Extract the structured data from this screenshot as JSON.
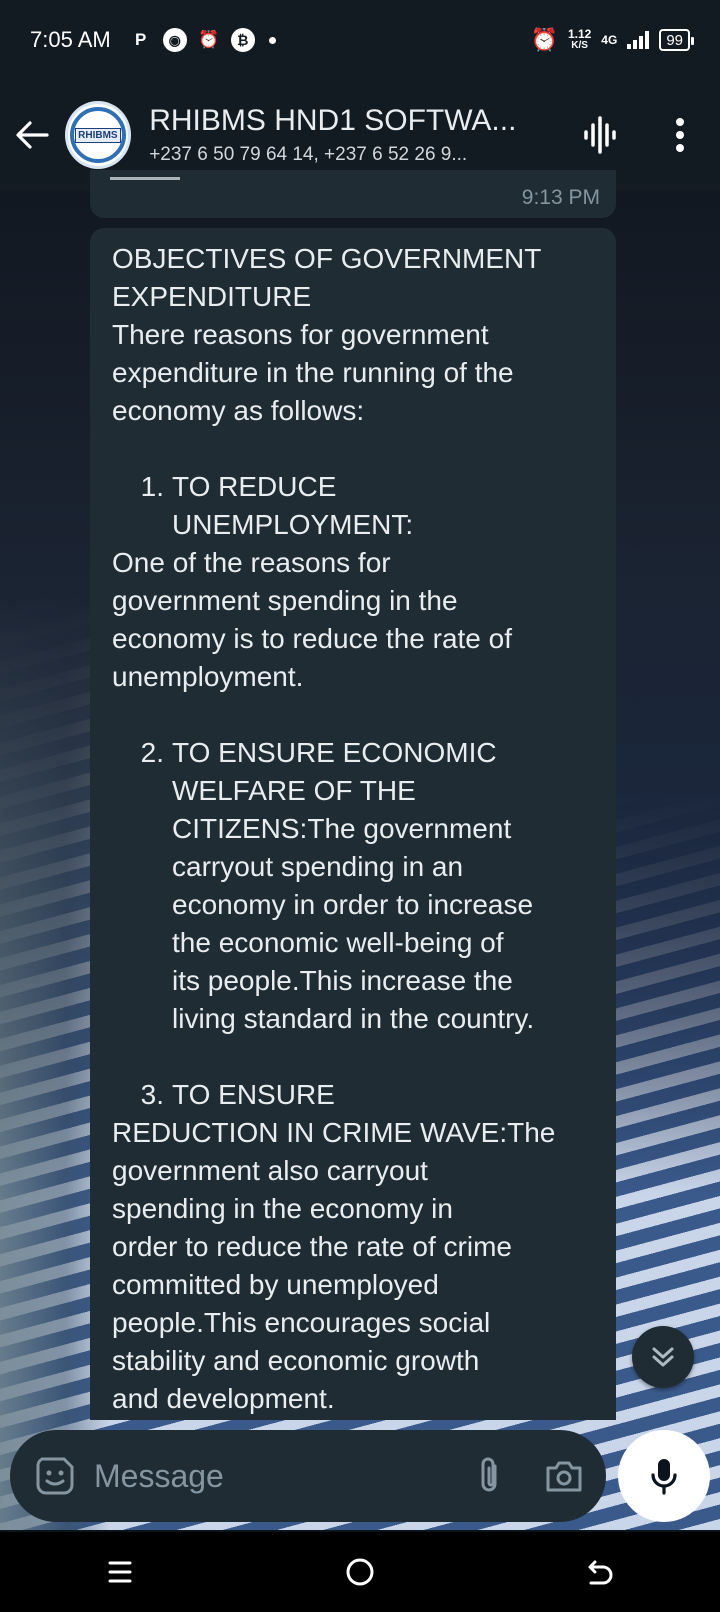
{
  "status_bar": {
    "time": "7:05 AM",
    "net_speed_value": "1.12",
    "net_speed_unit": "K/S",
    "network_type": "4G",
    "battery": "99",
    "icons": [
      "p-icon",
      "app-icon",
      "alarm-icon",
      "bitcoin-icon",
      "dot-icon",
      "alarm-clock-icon",
      "signal-icon",
      "battery-icon"
    ]
  },
  "header": {
    "title": "RHIBMS HND1 SOFTWA...",
    "subtitle": "+237 6 50 79 64 14, +237 6 52 26 9...",
    "avatar_text": "RHIBMS"
  },
  "previous_message": {
    "time": "9:13 PM"
  },
  "message": {
    "heading_1": "OBJECTIVES OF GOVERNMENT",
    "heading_2": "EXPENDITURE",
    "intro_1": "There reasons for government",
    "intro_2": "expenditure in the running of the",
    "intro_3": "economy as follows:",
    "item1_num": "1.",
    "item1_line1": "TO REDUCE",
    "item1_line2": "UNEMPLOYMENT:",
    "item1_body_1": "One of the reasons for",
    "item1_body_2": "government spending in the",
    "item1_body_3": "economy is to reduce the rate of",
    "item1_body_4": "unemployment.",
    "item2_num": "2.",
    "item2_line1": "TO ENSURE ECONOMIC",
    "item2_line2": "WELFARE OF THE",
    "item2_line3": "CITIZENS:The government",
    "item2_line4": "carryout spending in an",
    "item2_line5": "economy in order to increase",
    "item2_line6": "the economic well-being of",
    "item2_line7": "its people.This increase the",
    "item2_line8": "living standard in the country.",
    "item3_num": "3.",
    "item3_line1": "TO ENSURE",
    "item3_body_1": "REDUCTION IN CRIME WAVE:The",
    "item3_body_2": "government also carryout",
    "item3_body_3": "spending in the economy in",
    "item3_body_4": "order to reduce the rate of crime",
    "item3_body_5": "committed by unemployed",
    "item3_body_6": "people.This encourages social",
    "item3_body_7": "stability and economic growth",
    "item3_body_8": "and development."
  },
  "composer": {
    "placeholder": "Message"
  },
  "colors": {
    "bar_bg": "#121b22",
    "bubble_bg": "#1f2c34",
    "text": "#e9edef",
    "muted": "#8696a0"
  }
}
